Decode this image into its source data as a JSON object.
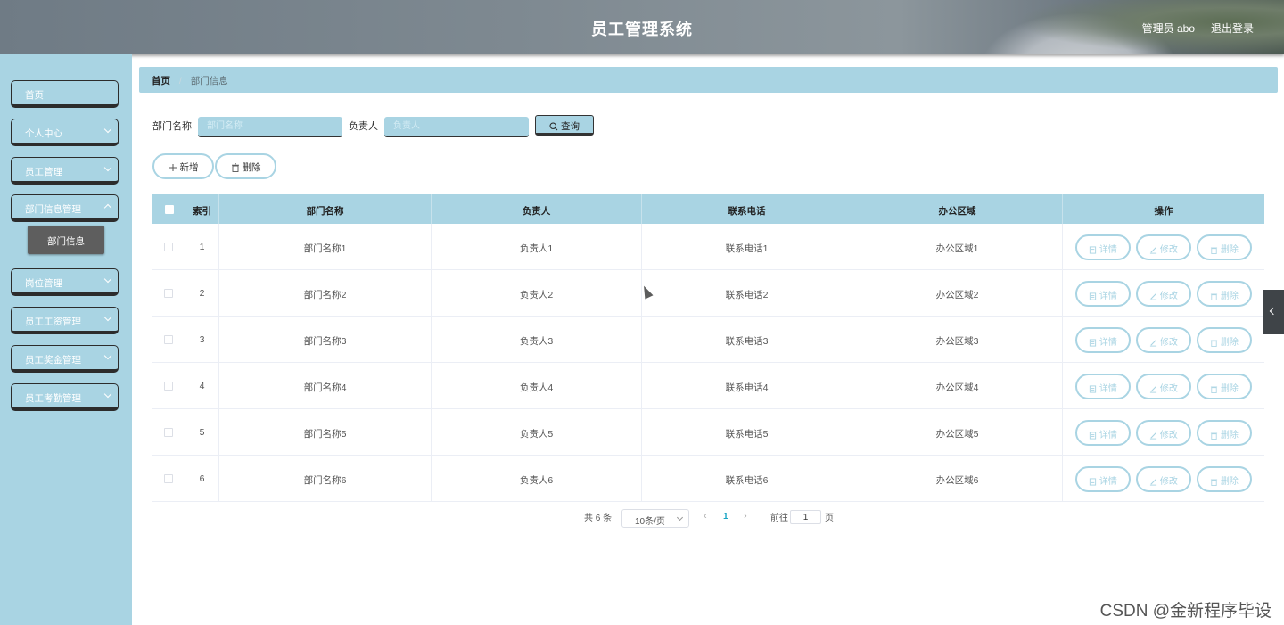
{
  "header": {
    "title": "员工管理系统",
    "user": "管理员 abo",
    "logout": "退出登录"
  },
  "sidebar": {
    "items": [
      {
        "label": "首页"
      },
      {
        "label": "个人中心"
      },
      {
        "label": "员工管理"
      },
      {
        "label": "部门信息管理"
      },
      {
        "label": "岗位管理"
      },
      {
        "label": "员工工资管理"
      },
      {
        "label": "员工奖金管理"
      },
      {
        "label": "员工考勤管理"
      }
    ],
    "submenu_active": "部门信息"
  },
  "breadcrumb": {
    "home": "首页",
    "separator": "/",
    "current": "部门信息"
  },
  "search": {
    "dept_label": "部门名称",
    "dept_placeholder": "部门名称",
    "owner_label": "负责人",
    "owner_placeholder": "负责人",
    "query_button": "查询"
  },
  "actions": {
    "add": "新增",
    "delete": "删除"
  },
  "table": {
    "columns": [
      "索引",
      "部门名称",
      "负责人",
      "联系电话",
      "办公区域",
      "操作"
    ],
    "rows": [
      {
        "index": "1",
        "name": "部门名称1",
        "owner": "负责人1",
        "phone": "联系电话1",
        "area": "办公区域1"
      },
      {
        "index": "2",
        "name": "部门名称2",
        "owner": "负责人2",
        "phone": "联系电话2",
        "area": "办公区域2"
      },
      {
        "index": "3",
        "name": "部门名称3",
        "owner": "负责人3",
        "phone": "联系电话3",
        "area": "办公区域3"
      },
      {
        "index": "4",
        "name": "部门名称4",
        "owner": "负责人4",
        "phone": "联系电话4",
        "area": "办公区域4"
      },
      {
        "index": "5",
        "name": "部门名称5",
        "owner": "负责人5",
        "phone": "联系电话5",
        "area": "办公区域5"
      },
      {
        "index": "6",
        "name": "部门名称6",
        "owner": "负责人6",
        "phone": "联系电话6",
        "area": "办公区域6"
      }
    ],
    "row_buttons": {
      "detail": "详情",
      "edit": "修改",
      "delete": "删除"
    }
  },
  "pagination": {
    "total": "共 6 条",
    "page_size": "10条/页",
    "current_page": "1",
    "goto_label": "前往",
    "goto_value": "1",
    "page_suffix": "页"
  },
  "watermark": "CSDN @金新程序毕设",
  "colors": {
    "accent": "#a9d4e3",
    "submenu_active_bg": "#5e5e5e",
    "page_active": "#19a5c4"
  }
}
